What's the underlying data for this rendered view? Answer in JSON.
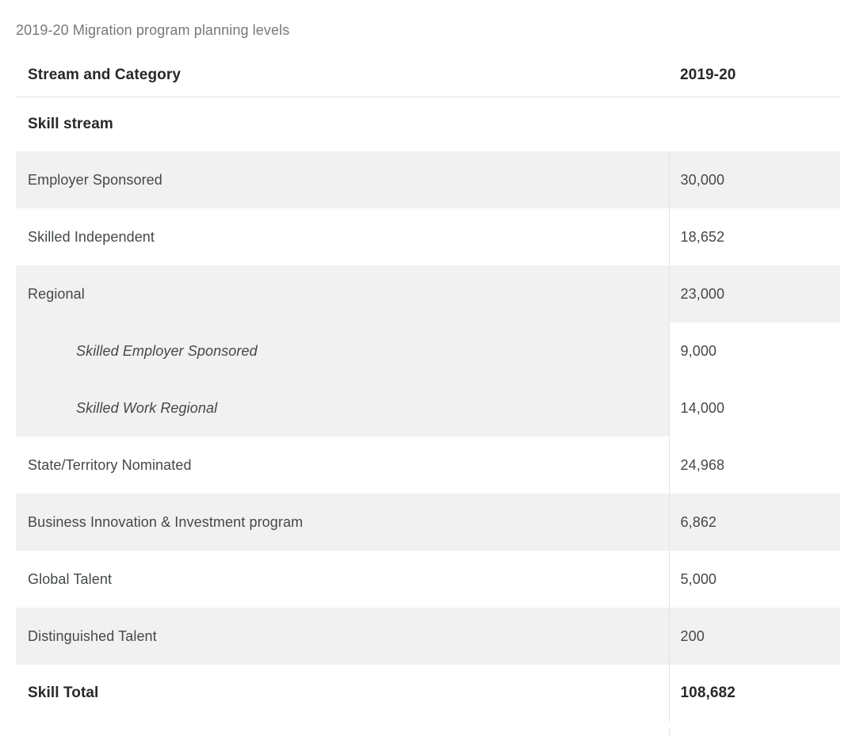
{
  "caption": "2019-20 Migration program planning levels",
  "table": {
    "columns": [
      {
        "key": "label",
        "header": "Stream and Category"
      },
      {
        "key": "value",
        "header": "2019-20"
      }
    ],
    "rows": [
      {
        "type": "section",
        "label": "Skill stream",
        "value": ""
      },
      {
        "type": "data",
        "label": "Employer Sponsored",
        "value": "30,000"
      },
      {
        "type": "data",
        "label": "Skilled Independent",
        "value": "18,652"
      },
      {
        "type": "data",
        "label": "Regional",
        "value": "23,000"
      },
      {
        "type": "sub",
        "label": "Skilled Employer Sponsored",
        "value": "9,000"
      },
      {
        "type": "sub",
        "label": "Skilled Work Regional",
        "value": "14,000"
      },
      {
        "type": "data",
        "label": "State/Territory Nominated",
        "value": "24,968"
      },
      {
        "type": "data",
        "label": "Business Innovation & Investment program",
        "value": "6,862"
      },
      {
        "type": "data",
        "label": "Global Talent",
        "value": "5,000"
      },
      {
        "type": "data",
        "label": "Distinguished Talent",
        "value": "200"
      },
      {
        "type": "total",
        "label": "Skill Total",
        "value": "108,682"
      }
    ]
  },
  "chart_data": {
    "type": "table",
    "title": "2019-20 Migration program planning levels",
    "columns": [
      "Stream and Category",
      "2019-20"
    ],
    "rows": [
      {
        "category": "Skill stream",
        "level": "section",
        "value": null
      },
      {
        "category": "Employer Sponsored",
        "level": "item",
        "value": 30000
      },
      {
        "category": "Skilled Independent",
        "level": "item",
        "value": 18652
      },
      {
        "category": "Regional",
        "level": "item",
        "value": 23000
      },
      {
        "category": "Skilled Employer Sponsored",
        "level": "sub-item",
        "value": 9000
      },
      {
        "category": "Skilled Work Regional",
        "level": "sub-item",
        "value": 14000
      },
      {
        "category": "State/Territory Nominated",
        "level": "item",
        "value": 24968
      },
      {
        "category": "Business Innovation & Investment program",
        "level": "item",
        "value": 6862
      },
      {
        "category": "Global Talent",
        "level": "item",
        "value": 5000
      },
      {
        "category": "Distinguished Talent",
        "level": "item",
        "value": 200
      },
      {
        "category": "Skill Total",
        "level": "total",
        "value": 108682
      }
    ]
  },
  "colors": {
    "page_background": "#ffffff",
    "row_stripe": "#f1f1f1",
    "border": "#e3e3e3",
    "caption_text": "#76787a",
    "body_text": "#44484b",
    "heading_text": "#26282a"
  }
}
